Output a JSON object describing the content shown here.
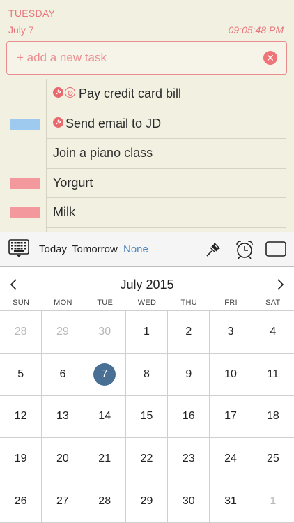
{
  "header": {
    "day": "TUESDAY",
    "date": "July 7",
    "time": "09:05:48 PM"
  },
  "add_task": {
    "placeholder": "+ add a new task",
    "value": ""
  },
  "tasks": [
    {
      "label": "Pay credit card bill",
      "color": "",
      "pinned": true,
      "alarm": true,
      "done": false
    },
    {
      "label": "Send email to JD",
      "color": "#9fcaf0",
      "pinned": true,
      "alarm": false,
      "done": false
    },
    {
      "label": "Join a piano class",
      "color": "",
      "pinned": false,
      "alarm": false,
      "done": true
    },
    {
      "label": "Yorgurt",
      "color": "#f3989c",
      "pinned": false,
      "alarm": false,
      "done": false
    },
    {
      "label": "Milk",
      "color": "#f3989c",
      "pinned": false,
      "alarm": false,
      "done": false
    }
  ],
  "toolbar": {
    "today": "Today",
    "tomorrow": "Tomorrow",
    "none": "None",
    "selected": "none"
  },
  "calendar": {
    "month": "July 2015",
    "weekdays": [
      "SUN",
      "MON",
      "TUE",
      "WED",
      "THU",
      "FRI",
      "SAT"
    ],
    "selected_day": "7",
    "weeks": [
      [
        {
          "d": "28",
          "m": true
        },
        {
          "d": "29",
          "m": true
        },
        {
          "d": "30",
          "m": true
        },
        {
          "d": "1"
        },
        {
          "d": "2"
        },
        {
          "d": "3"
        },
        {
          "d": "4"
        }
      ],
      [
        {
          "d": "5"
        },
        {
          "d": "6"
        },
        {
          "d": "7"
        },
        {
          "d": "8"
        },
        {
          "d": "9"
        },
        {
          "d": "10"
        },
        {
          "d": "11"
        }
      ],
      [
        {
          "d": "12"
        },
        {
          "d": "13"
        },
        {
          "d": "14"
        },
        {
          "d": "15"
        },
        {
          "d": "16"
        },
        {
          "d": "17"
        },
        {
          "d": "18"
        }
      ],
      [
        {
          "d": "19"
        },
        {
          "d": "20"
        },
        {
          "d": "21"
        },
        {
          "d": "22"
        },
        {
          "d": "23"
        },
        {
          "d": "24"
        },
        {
          "d": "25"
        }
      ],
      [
        {
          "d": "26"
        },
        {
          "d": "27"
        },
        {
          "d": "28"
        },
        {
          "d": "29"
        },
        {
          "d": "30"
        },
        {
          "d": "31"
        },
        {
          "d": "1",
          "m": true
        }
      ]
    ]
  },
  "colors": {
    "accent_red": "#e8777d",
    "paper": "#f2f0e1",
    "blue": "#4d88bf",
    "selected_day": "#4a6f95"
  }
}
